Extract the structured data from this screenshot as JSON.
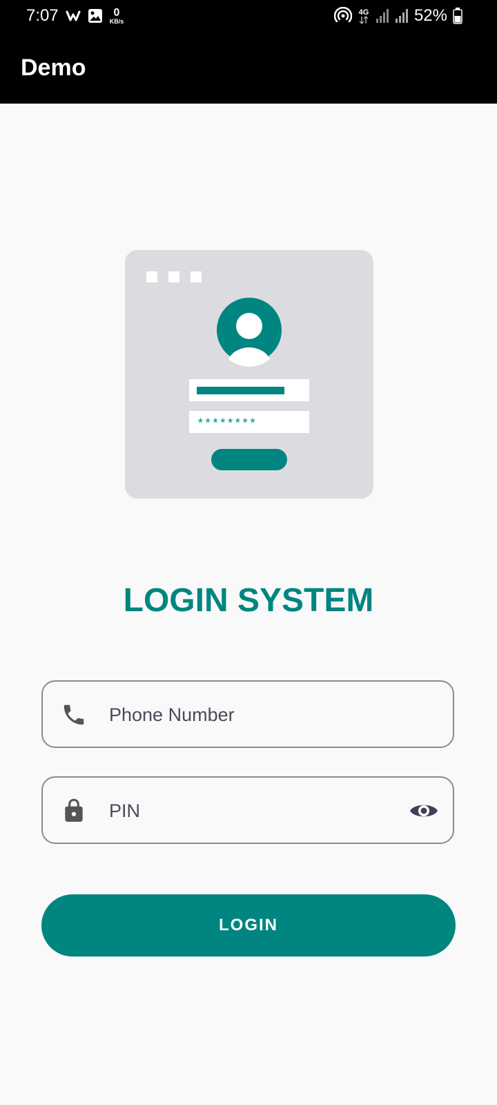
{
  "status_bar": {
    "time": "7:07",
    "speed_value": "0",
    "speed_unit": "KB/s",
    "network_type": "4G",
    "battery": "52%",
    "icons": [
      "wifi-calling-icon",
      "gallery-icon",
      "hotspot-icon",
      "4g-icon",
      "signal-icon",
      "battery-icon"
    ]
  },
  "app_bar": {
    "title": "Demo"
  },
  "illustration": {
    "masked_password": "********",
    "icon": "user-login-illustration"
  },
  "main": {
    "title": "LOGIN SYSTEM",
    "phone_placeholder": "Phone Number",
    "pin_placeholder": "PIN",
    "login_label": "LOGIN"
  },
  "colors": {
    "accent": "#008580",
    "app_bar_background": "#000000",
    "page_background": "#F9F9F9",
    "illustration_panel": "#DCDCE0"
  }
}
